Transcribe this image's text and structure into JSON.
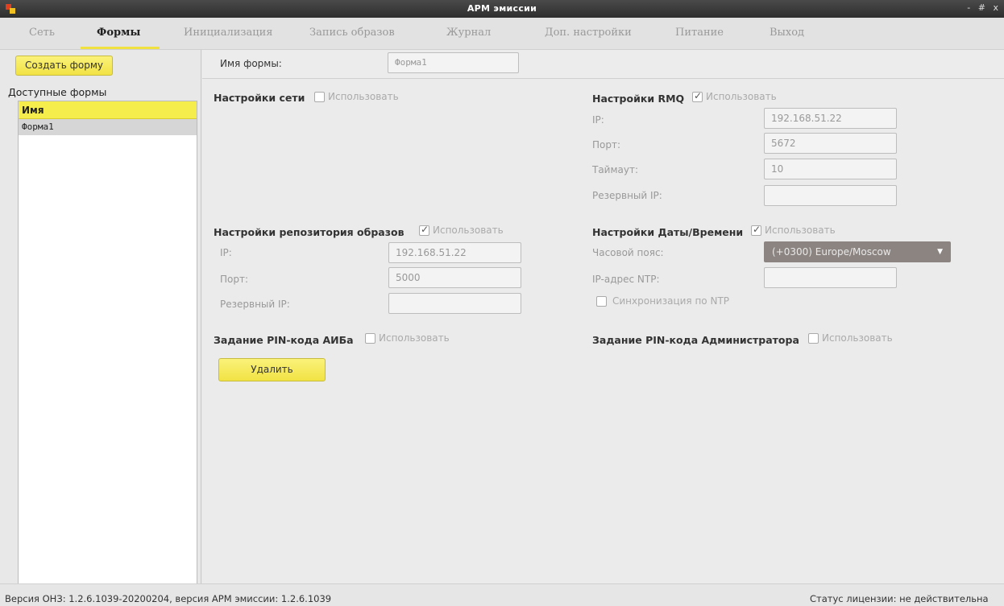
{
  "window": {
    "title": "АРМ эмиссии",
    "controls": "- # x",
    "app_icon": "app-logo-icon"
  },
  "tabs": [
    {
      "label": "Сеть",
      "active": false
    },
    {
      "label": "Формы",
      "active": true
    },
    {
      "label": "Инициализация",
      "active": false
    },
    {
      "label": "Запись образов",
      "active": false
    },
    {
      "label": "Журнал",
      "active": false
    },
    {
      "label": "Доп. настройки",
      "active": false
    },
    {
      "label": "Питание",
      "active": false
    },
    {
      "label": "Выход",
      "active": false
    }
  ],
  "sidebar": {
    "create_button": "Создать форму",
    "heading": "Доступные формы",
    "list_header": "Имя",
    "items": [
      "Форма1"
    ]
  },
  "form": {
    "name_label": "Имя формы:",
    "name_value": "Форма1"
  },
  "network": {
    "title": "Настройки сети",
    "use_label": "Использовать",
    "use_checked": false
  },
  "rmq": {
    "title": "Настройки RMQ",
    "use_label": "Использовать",
    "use_checked": true,
    "ip_label": "IP:",
    "ip_value": "192.168.51.22",
    "port_label": "Порт:",
    "port_value": "5672",
    "timeout_label": "Таймаут:",
    "timeout_value": "10",
    "backup_ip_label": "Резервный IP:",
    "backup_ip_value": ""
  },
  "repo": {
    "title": "Настройки репозитория образов",
    "use_label": "Использовать",
    "use_checked": true,
    "ip_label": "IP:",
    "ip_value": "192.168.51.22",
    "port_label": "Порт:",
    "port_value": "5000",
    "backup_ip_label": "Резервный IP:",
    "backup_ip_value": ""
  },
  "datetime": {
    "title": "Настройки Даты/Времени",
    "use_label": "Использовать",
    "use_checked": true,
    "tz_label": "Часовой пояс:",
    "tz_value": "(+0300) Europe/Moscow",
    "ntp_label": "IP-адрес NTP:",
    "ntp_value": "",
    "ntp_sync_label": "Синхронизация по NTP",
    "ntp_sync_checked": false
  },
  "pin_aib": {
    "title": "Задание PIN-кода АИБа",
    "use_label": "Использовать",
    "use_checked": false
  },
  "pin_admin": {
    "title": "Задание PIN-кода Администратора",
    "use_label": "Использовать",
    "use_checked": false
  },
  "delete_button": "Удалить",
  "status": {
    "version": "Версия ОНЗ: 1.2.6.1039-20200204, версия АРМ эмиссии: 1.2.6.1039",
    "license": "Статус лицензии: не действительна"
  },
  "colors": {
    "accent_yellow": "#f5ed4c",
    "titlebar": "#3a3a3a",
    "select_bg": "#8c8480"
  }
}
